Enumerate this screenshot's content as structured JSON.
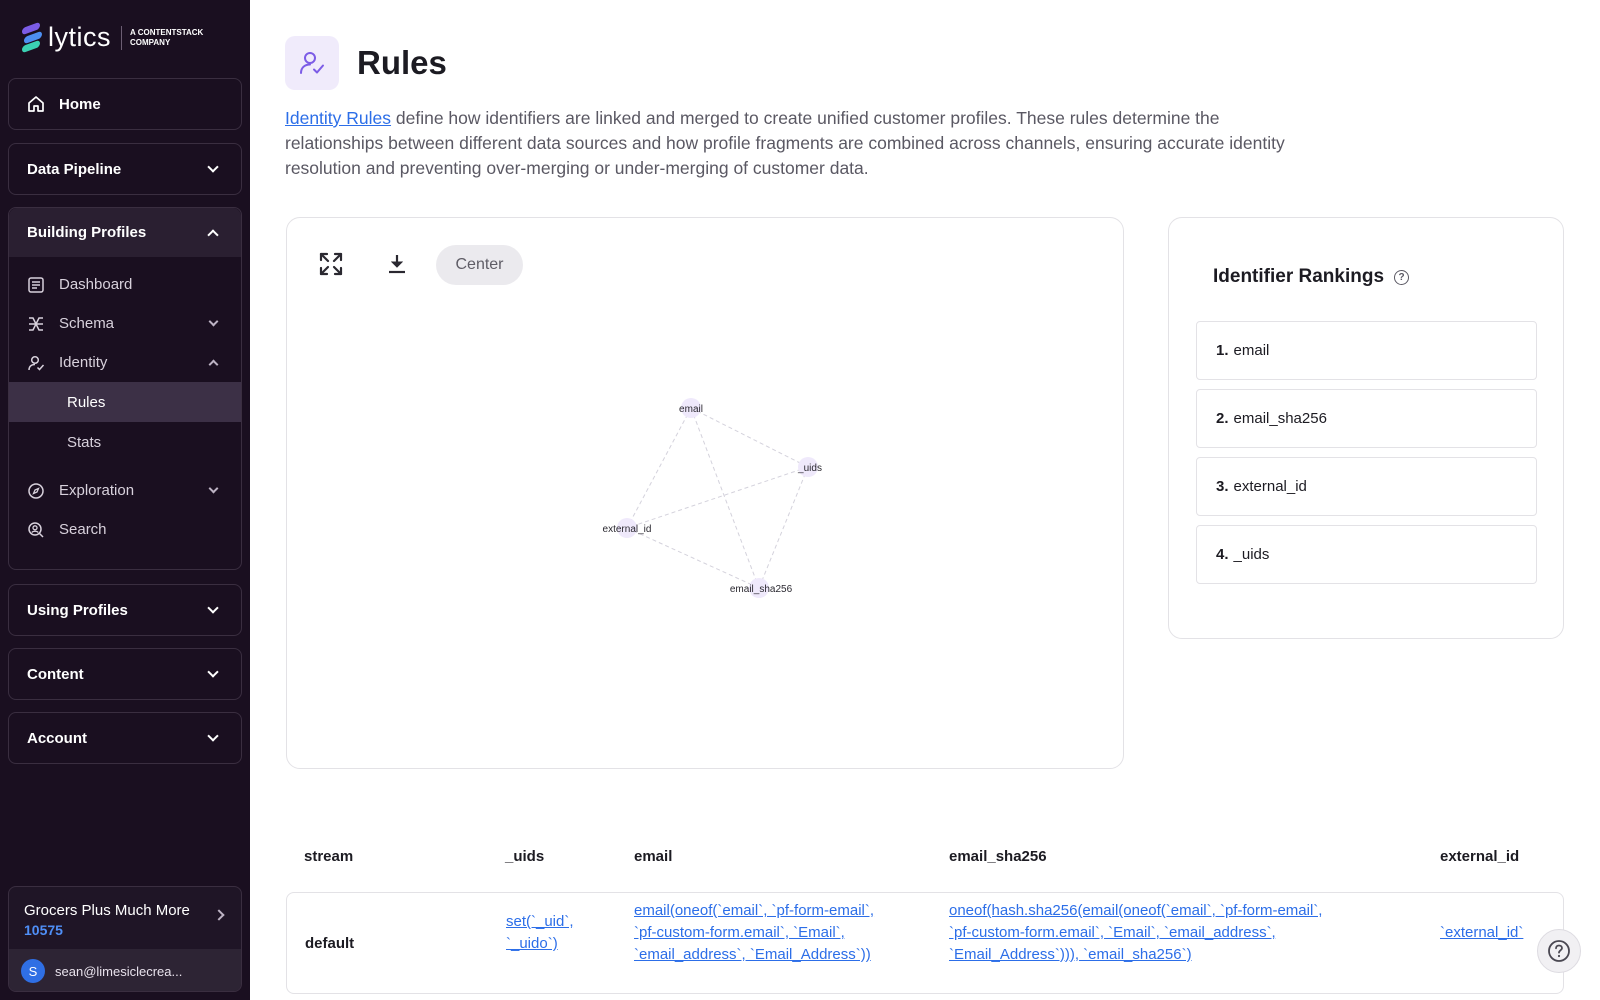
{
  "brand": {
    "name": "lytics",
    "tagline_line1": "A CONTENTSTACK",
    "tagline_line2": "COMPANY",
    "colors": {
      "sidebar_bg": "#1a0f20",
      "accent": "#7c5ce6",
      "link": "#2c6ee8"
    }
  },
  "sidebar": {
    "home": "Home",
    "data_pipeline": "Data Pipeline",
    "building_profiles": {
      "label": "Building Profiles",
      "items": {
        "dashboard": "Dashboard",
        "schema": "Schema",
        "identity": "Identity",
        "rules": "Rules",
        "stats": "Stats",
        "exploration": "Exploration",
        "search": "Search"
      }
    },
    "using_profiles": "Using Profiles",
    "content": "Content",
    "account": "Account",
    "account_box": {
      "name": "Grocers Plus Much More",
      "id": "10575",
      "avatar_letter": "S",
      "user_email": "sean@limesiclecrea..."
    }
  },
  "page": {
    "title": "Rules",
    "description_link": "Identity Rules",
    "description_text": " define how identifiers are linked and merged to create unified customer profiles. These rules determine the relationships between different data sources and how profile fragments are combined across channels, ensuring accurate identity resolution and preventing over-merging or under-merging of customer data."
  },
  "graph": {
    "center_label": "Center",
    "icons": [
      "expand-icon",
      "download-icon"
    ],
    "nodes": [
      {
        "id": "email",
        "label": "email"
      },
      {
        "id": "_uids",
        "label": "_uids"
      },
      {
        "id": "external_id",
        "label": "external_id"
      },
      {
        "id": "email_sha256",
        "label": "email_sha256"
      }
    ],
    "edges": [
      [
        "email",
        "_uids"
      ],
      [
        "email",
        "external_id"
      ],
      [
        "email",
        "email_sha256"
      ],
      [
        "_uids",
        "external_id"
      ],
      [
        "_uids",
        "email_sha256"
      ],
      [
        "external_id",
        "email_sha256"
      ]
    ]
  },
  "rankings": {
    "title": "Identifier Rankings",
    "items": [
      {
        "num": "1.",
        "name": "email"
      },
      {
        "num": "2.",
        "name": "email_sha256"
      },
      {
        "num": "3.",
        "name": "external_id"
      },
      {
        "num": "4.",
        "name": "_uids"
      }
    ]
  },
  "table": {
    "headers": [
      "stream",
      "_uids",
      "email",
      "email_sha256",
      "external_id"
    ],
    "rows": [
      {
        "stream": "default",
        "uids_line1": "set(`_uid`,",
        "uids_line2": "`_uido`)",
        "email_line1": "email(oneof(`email`, `pf-form-email`,",
        "email_line2": "`pf-custom-form.email`, `Email`,",
        "email_line3": "`email_address`, `Email_Address`))",
        "sha_line1": "oneof(hash.sha256(email(oneof(`email`, `pf-form-email`,",
        "sha_line2": "`pf-custom-form.email`, `Email`, `email_address`,",
        "sha_line3": "`Email_Address`))), `email_sha256`)",
        "external_id": "`external_id`"
      }
    ]
  }
}
